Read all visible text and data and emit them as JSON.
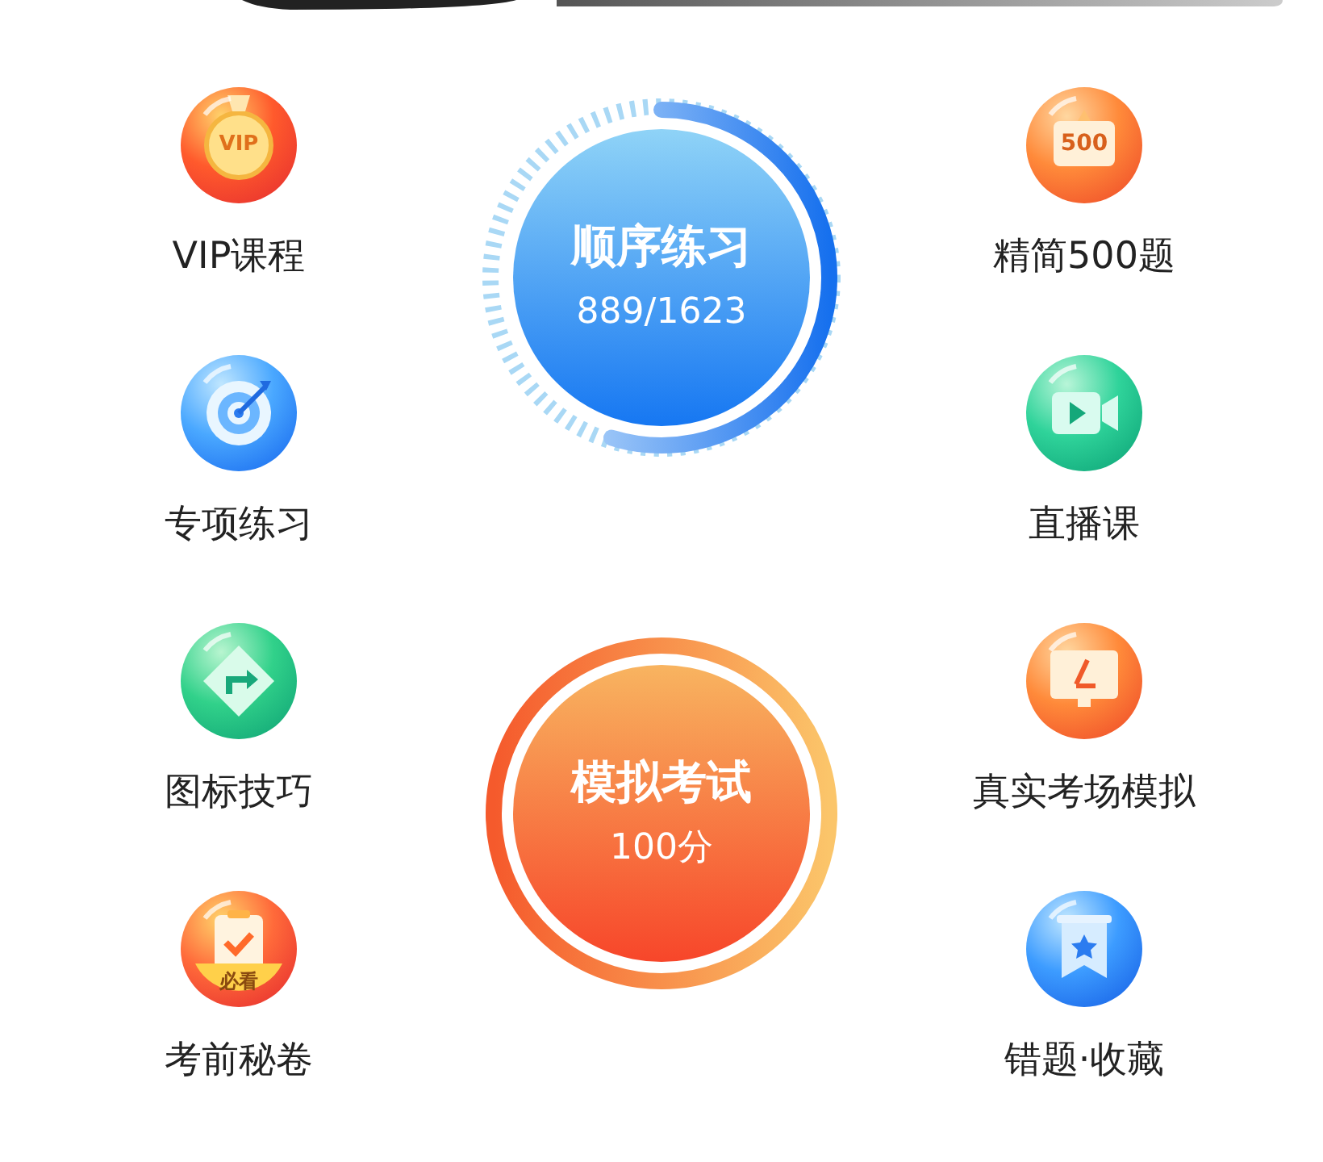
{
  "left_items": [
    {
      "label": "VIP课程",
      "kind": "vip",
      "badge": "VIP"
    },
    {
      "label": "专项练习",
      "kind": "target"
    },
    {
      "label": "图标技巧",
      "kind": "sign"
    },
    {
      "label": "考前秘卷",
      "kind": "exam",
      "badge": "必看"
    }
  ],
  "practice": {
    "title": "顺序练习",
    "progress": "889/1623",
    "level": 0.548
  },
  "exam": {
    "title": "模拟考试",
    "score": "100分"
  },
  "right_items": [
    {
      "label": "精简500题",
      "kind": "board",
      "badge": "500"
    },
    {
      "label": "直播课",
      "kind": "video"
    },
    {
      "label": "真实考场模拟",
      "kind": "monitor"
    },
    {
      "label": "错题·收藏",
      "kind": "bookmark"
    }
  ]
}
